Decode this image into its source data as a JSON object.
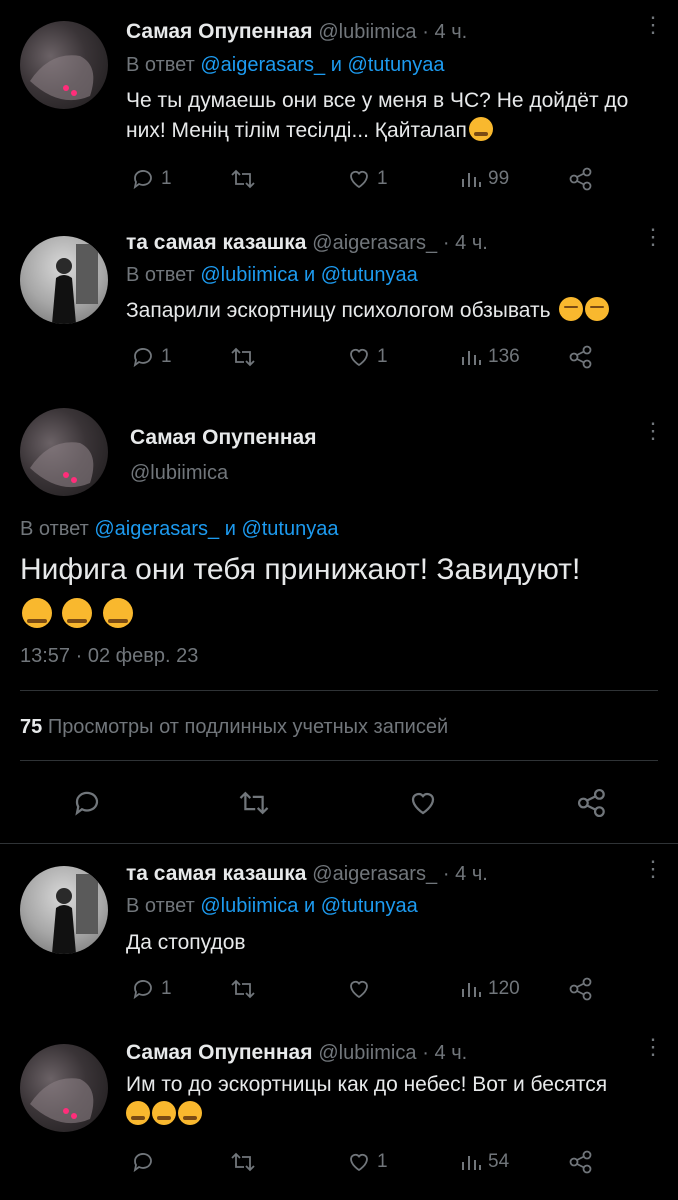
{
  "replies": [
    {
      "name": "Самая Опупенная",
      "handle": "@lubiimica",
      "time": "· 4 ч.",
      "reply_prefix": "В ответ",
      "reply_to_1": "@aigerasars_",
      "reply_and": "и",
      "reply_to_2": "@tutunyaa",
      "text_line1": "Че ты думаешь они все у меня в ЧС? Не дойдёт до",
      "text_line2": "них! Менің тілім тесілді... Қайталап",
      "replies_count": "1",
      "retweets_count": "",
      "likes_count": "1",
      "views_count": "99"
    },
    {
      "name": "та самая казашка",
      "handle": "@aigerasars_",
      "time": "· 4 ч.",
      "reply_prefix": "В ответ",
      "reply_to_1": "@lubiimica",
      "reply_and": "и",
      "reply_to_2": "@tutunyaa",
      "text_line1": "Запарили эскортницу психологом обзывать",
      "replies_count": "1",
      "retweets_count": "",
      "likes_count": "1",
      "views_count": "136"
    }
  ],
  "main_tweet": {
    "name": "Самая Опупенная",
    "handle": "@lubiimica",
    "reply_prefix": "В ответ",
    "reply_to_1": "@aigerasars_",
    "reply_and": "и",
    "reply_to_2": "@tutunyaa",
    "text_line1": "Нифига они тебя принижают! Завидуют!",
    "timestamp": "13:57 · 02 февр. 23",
    "views_number": "75",
    "views_label": "Просмотры от подлинных учетных записей"
  },
  "replies_after": [
    {
      "name": "та самая казашка",
      "handle": "@aigerasars_",
      "time": "· 4 ч.",
      "reply_prefix": "В ответ",
      "reply_to_1": "@lubiimica",
      "reply_and": "и",
      "reply_to_2": "@tutunyaa",
      "text_line1": "Да стопудов",
      "replies_count": "1",
      "retweets_count": "",
      "likes_count": "",
      "views_count": "120"
    },
    {
      "name": "Самая Опупенная",
      "handle": "@lubiimica",
      "time": "· 4 ч.",
      "text_line1": "Им то до эскортницы как до небес! Вот и бесятся",
      "replies_count": "",
      "retweets_count": "",
      "likes_count": "1",
      "views_count": "54"
    }
  ],
  "colors": {
    "background": "#000000",
    "text": "#e7e9ea",
    "muted": "#71767b",
    "link": "#1d9bf0",
    "divider": "#2f3336"
  },
  "icons": [
    "reply-icon",
    "retweet-icon",
    "like-icon",
    "views-icon",
    "share-icon",
    "more-icon"
  ]
}
